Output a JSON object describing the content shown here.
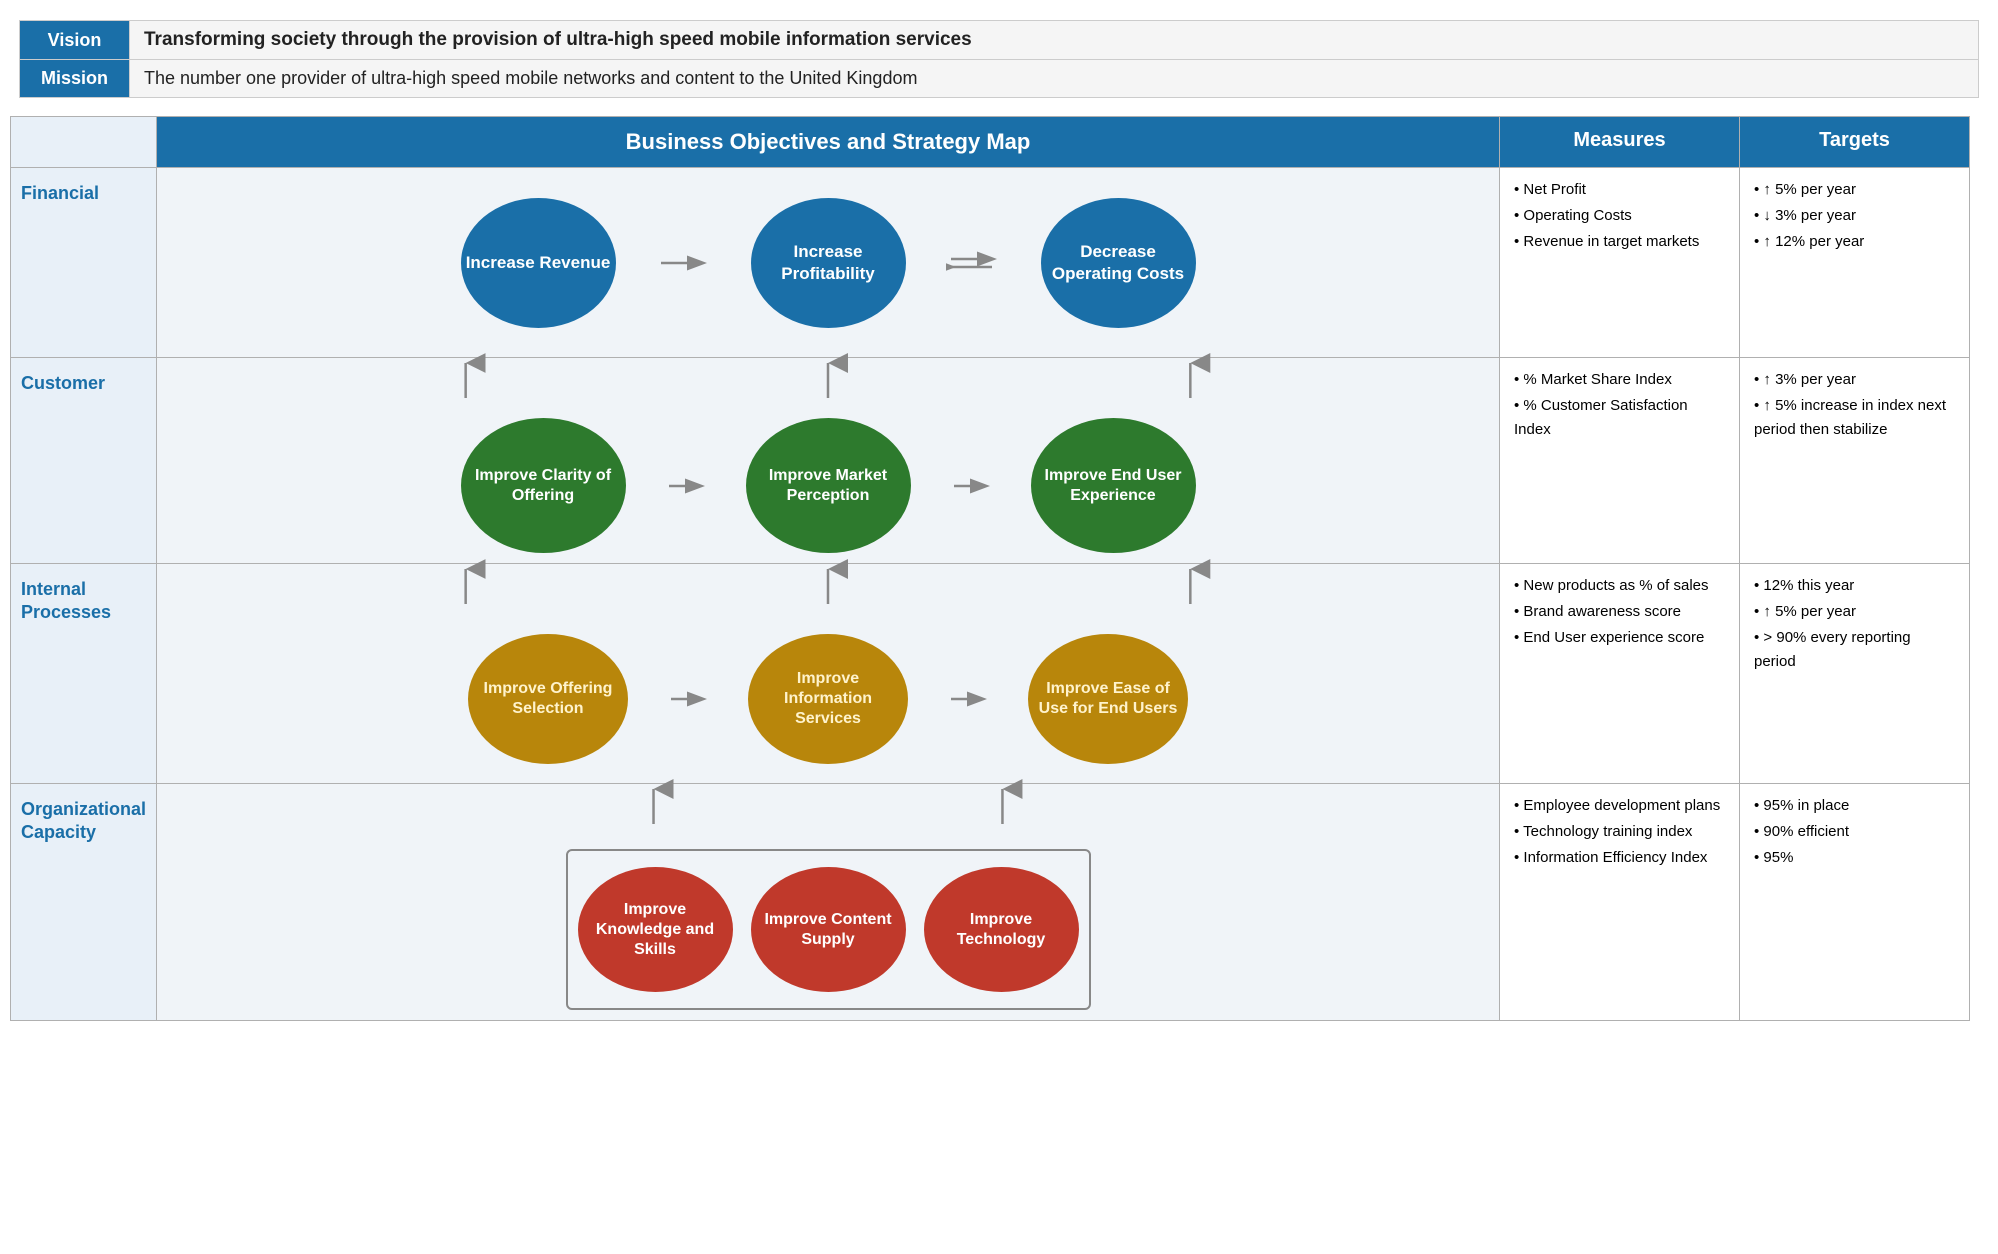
{
  "vision": {
    "label": "Vision",
    "text": "Transforming society through the provision of ultra-high speed mobile information services"
  },
  "mission": {
    "label": "Mission",
    "text": "The number one provider of ultra-high speed mobile networks and content to the United Kingdom"
  },
  "header": {
    "map_title": "Business Objectives and Strategy Map",
    "measures_title": "Measures",
    "targets_title": "Targets"
  },
  "rows": {
    "financial": {
      "label": "Financial",
      "ellipses": [
        {
          "id": "increase-revenue",
          "text": "Increase Revenue"
        },
        {
          "id": "increase-profitability",
          "text": "Increase Profitability"
        },
        {
          "id": "decrease-operating-costs",
          "text": "Decrease Operating Costs"
        }
      ],
      "measures": [
        "Net Profit",
        "Operating Costs",
        "Revenue in target markets"
      ],
      "targets": [
        "↑ 5% per year",
        "↓ 3% per year",
        "↑ 12% per year"
      ]
    },
    "customer": {
      "label": "Customer",
      "ellipses": [
        {
          "id": "improve-clarity",
          "text": "Improve Clarity of Offering"
        },
        {
          "id": "improve-market",
          "text": "Improve Market Perception"
        },
        {
          "id": "improve-end-user",
          "text": "Improve End User Experience"
        }
      ],
      "measures": [
        "% Market Share Index",
        "% Customer Satisfaction Index"
      ],
      "targets": [
        "↑ 3% per year",
        "↑ 5% increase in index next period then stabilize"
      ]
    },
    "internal": {
      "label": "Internal Processes",
      "ellipses": [
        {
          "id": "improve-offering-selection",
          "text": "Improve Offering Selection"
        },
        {
          "id": "improve-information",
          "text": "Improve Information Services"
        },
        {
          "id": "improve-ease",
          "text": "Improve Ease of Use for End Users"
        }
      ],
      "measures": [
        "New products as % of sales",
        "Brand awareness score",
        "End User experience score"
      ],
      "targets": [
        "12% this year",
        "↑ 5% per year",
        "> 90% every reporting period"
      ]
    },
    "org": {
      "label": "Organizational Capacity",
      "ellipses": [
        {
          "id": "improve-knowledge",
          "text": "Improve Knowledge and Skills"
        },
        {
          "id": "improve-content",
          "text": "Improve Content Supply"
        },
        {
          "id": "improve-technology",
          "text": "Improve Technology"
        }
      ],
      "measures": [
        "Employee development plans",
        "Technology training index",
        "Information Efficiency Index"
      ],
      "targets": [
        "95% in place",
        "90% efficient",
        "95%"
      ]
    }
  }
}
